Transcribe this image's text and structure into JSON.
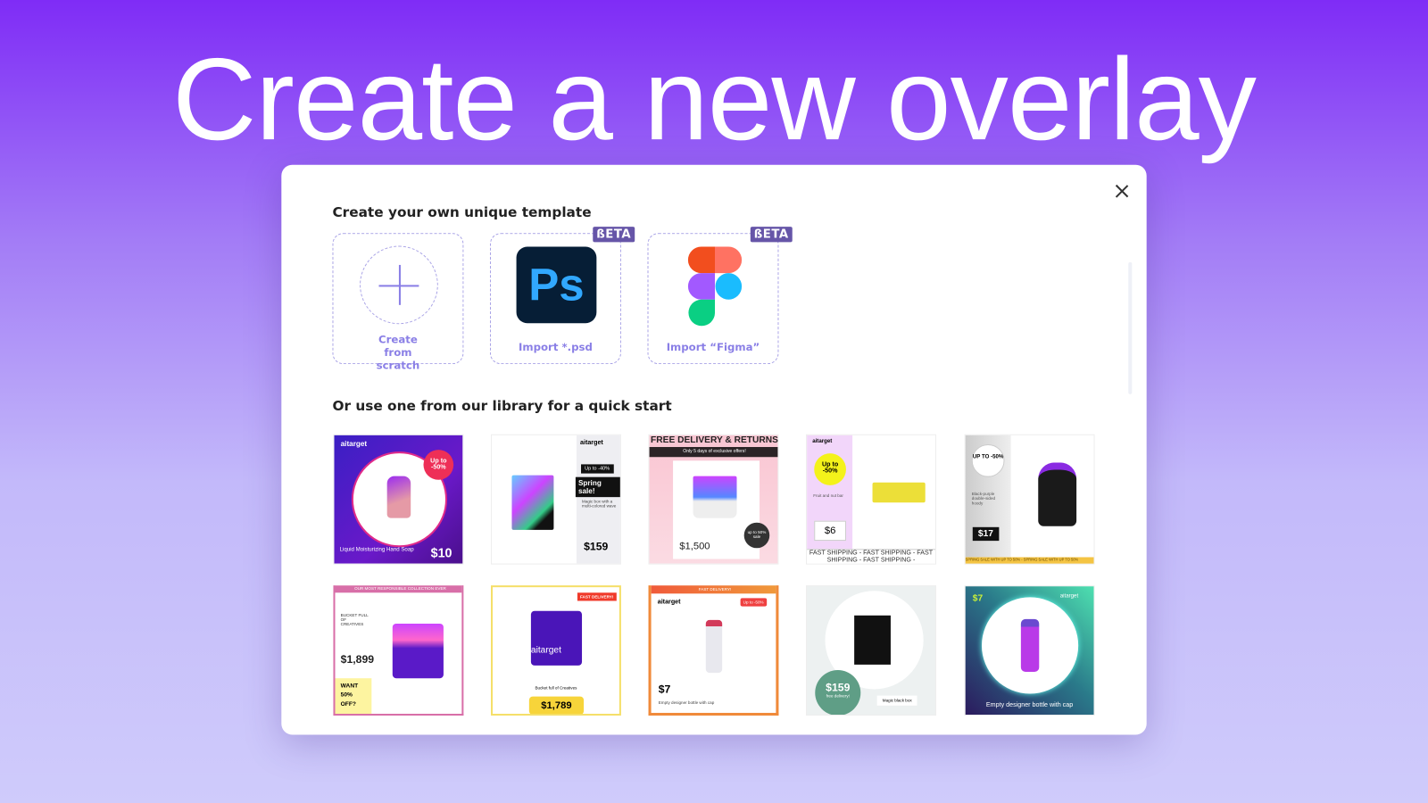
{
  "hero_title": "Create a new overlay",
  "modal": {
    "section1_title": "Create your own unique template",
    "section2_title": "Or use one from our library for a quick start",
    "options": [
      {
        "label": "Create from scratch",
        "icon": "plus-icon"
      },
      {
        "label": "Import *.psd",
        "icon": "photoshop-icon",
        "badge": "ßETA",
        "icon_text": "Ps"
      },
      {
        "label": "Import “Figma”",
        "icon": "figma-icon",
        "badge": "ßETA"
      }
    ],
    "templates": [
      {
        "brand": "aitarget",
        "badge": "Up to -50%",
        "caption": "Liquid Moisturizing Hand Soap",
        "price": "$10"
      },
      {
        "brand": "aitarget",
        "badge": "Up to -40%",
        "headline": "Spring sale!",
        "caption": "Magic box with a multi-colored wave",
        "price": "$159"
      },
      {
        "headline": "FREE DELIVERY & RETURNS",
        "subline": "Only 5 days of exclusive offers!",
        "badge": "up to 50% sale",
        "price": "$1,500"
      },
      {
        "brand": "aitarget",
        "badge": "Up to -50%",
        "caption": "Fruit and nut bar",
        "price": "$6",
        "ticker": "FAST SHIPPING - FAST SHIPPING - FAST SHIPPING - FAST SHIPPING -"
      },
      {
        "badge": "UP TO -50%",
        "caption": "Black-purple double-sided hoody",
        "price": "$17",
        "ticker": "SPRING SALE WITH UP TO 50% - SPRING SALE WITH UP TO 50%"
      },
      {
        "headline": "OUR MOST RESPONSIBLE COLLECTION EVER",
        "caption": "BUCKET FULL OF CREATIVES",
        "price": "$1,899",
        "badge": "WANT 50% OFF?"
      },
      {
        "badge": "FAST DELIVERY!",
        "product_text": "aitarget",
        "caption": "Bucket full of Creatives",
        "price": "$1,789"
      },
      {
        "headline": "FAST DELIVERY!",
        "brand": "aitarget",
        "badge": "Up to -50%",
        "price": "$7",
        "caption": "Empty designer bottle with cap"
      },
      {
        "price": "$159",
        "subline": "free delivery!",
        "caption": "Magic black box"
      },
      {
        "price": "$7",
        "brand": "aitarget",
        "caption": "Empty designer bottle with cap"
      }
    ]
  },
  "colors": {
    "accent": "#8a7fe6",
    "beta": "#6655a8"
  }
}
